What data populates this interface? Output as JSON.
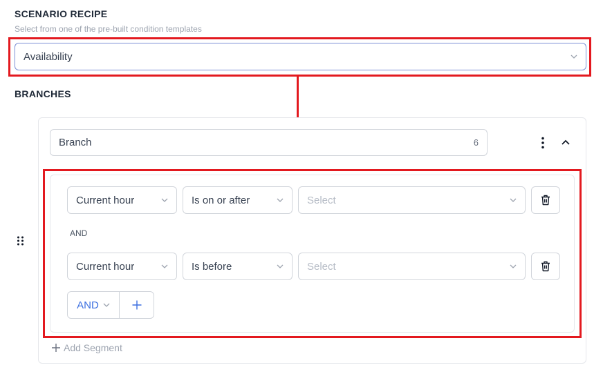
{
  "scenario": {
    "title": "SCENARIO RECIPE",
    "description": "Select from one of the pre-built condition templates",
    "selected": "Availability"
  },
  "branches": {
    "title": "BRANCHES",
    "branch_name": "Branch",
    "char_count": "6"
  },
  "conditions": [
    {
      "field": "Current hour",
      "operator": "Is on or after",
      "value_placeholder": "Select"
    },
    {
      "field": "Current hour",
      "operator": "Is before",
      "value_placeholder": "Select"
    }
  ],
  "joiner_label": "AND",
  "join_button_label": "AND",
  "add_segment_label": "Add Segment",
  "colors": {
    "highlight": "#e3191f",
    "accent": "#3b6fe0",
    "focus_border": "#7b8fd6"
  },
  "icons": {
    "chevron": "chevron-down-icon",
    "delete": "trash-icon",
    "drag": "drag-handle-icon",
    "more": "kebab-menu-icon",
    "collapse": "chevron-up-icon",
    "add": "plus-icon"
  }
}
